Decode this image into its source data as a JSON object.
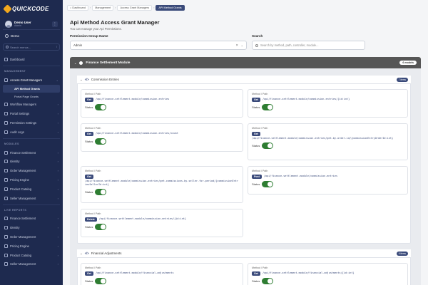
{
  "sidebar": {
    "logo_text": "QUICKCODE",
    "user": {
      "name": "Demo User",
      "role": "Admin",
      "menu": "⋮"
    },
    "tenant": "Demo",
    "search_placeholder": "Search menus...",
    "search_key": "/",
    "dashboard": "Dashboard",
    "management_label": "MANAGEMENT",
    "access_grant_managers": "Access Grant Managers",
    "api_method_grants": "API Method Grants",
    "portal_page_grants": "Portal Page Grants",
    "workflow_managers": "Workflow Managers",
    "portal_settings": "Portal Settings",
    "permission_settings": "Permission Settings",
    "audit_logs": "Audit Logs",
    "modules_label": "MODULES",
    "modules": [
      "Finance Settlement",
      "Identity",
      "Order Management",
      "Pricing Engine",
      "Product Catalog",
      "Seller Management"
    ],
    "live_reports_label": "LIVE REPORTS",
    "live_reports": [
      "Finance Settlement",
      "Identity",
      "Order Management",
      "Pricing Engine",
      "Product Catalog",
      "Seller Management"
    ]
  },
  "breadcrumb": {
    "home": "Dashboard",
    "c1": "Management",
    "c2": "Access Grant Managers",
    "current": "API Method Grants"
  },
  "page": {
    "title": "Api Method Access Grant Manager",
    "subtitle": "You can manage your Api Permissions.",
    "group_label": "Permission Group Name",
    "group_value": "Admin",
    "search_label": "Search",
    "search_placeholder": "Search by method, path, controller, module..."
  },
  "module": {
    "name": "Finance Settlement Module",
    "count": "6 models"
  },
  "groups": [
    {
      "name": "Commission Entries",
      "count": "7 items",
      "entries": [
        {
          "mp": "Method / Path",
          "method": "Get",
          "path": "/api/finance-settlement-module/commission-entries",
          "status": "Status",
          "enabled": true
        },
        {
          "mp": "Method / Path",
          "method": "Get",
          "path": "/api/finance-settlement-module/commission-entries/{id:int}",
          "status": "Status",
          "enabled": true
        },
        {
          "mp": "Method / Path",
          "method": "Get",
          "path": "/api/finance-settlement-module/commission-entries/count",
          "status": "Status",
          "enabled": true
        },
        {
          "mp": "Method / Path",
          "method": "Get",
          "path": "/api/finance-settlement-module/commission-entries/get-by-order-id/{commissionEntryOrderId:int}",
          "status": "Status",
          "enabled": true
        },
        {
          "mp": "Method / Path",
          "method": "Get",
          "path": "/api/finance-settlement-module/commission-entries/get-commissions-by-seller-for-period/{commissionEntriesSellerId:int}",
          "status": "Status",
          "enabled": true
        },
        {
          "mp": "Method / Path",
          "method": "Post",
          "path": "/api/finance-settlement-module/commission-entries",
          "status": "Status",
          "enabled": true
        },
        {
          "mp": "Method / Path",
          "method": "Delete",
          "path": "/api/finance-settlement-module/commission-entries/{id:int}",
          "status": "Status",
          "enabled": true
        }
      ]
    },
    {
      "name": "Financial Adjustments",
      "count": "6 items",
      "entries": [
        {
          "mp": "Method / Path",
          "method": "Get",
          "path": "/api/finance-settlement-module/financial-adjustments",
          "status": "Status",
          "enabled": true
        },
        {
          "mp": "Method / Path",
          "method": "Get",
          "path": "/api/finance-settlement-module/financial-adjustments/{id:int}",
          "status": "Status",
          "enabled": true
        }
      ]
    }
  ]
}
